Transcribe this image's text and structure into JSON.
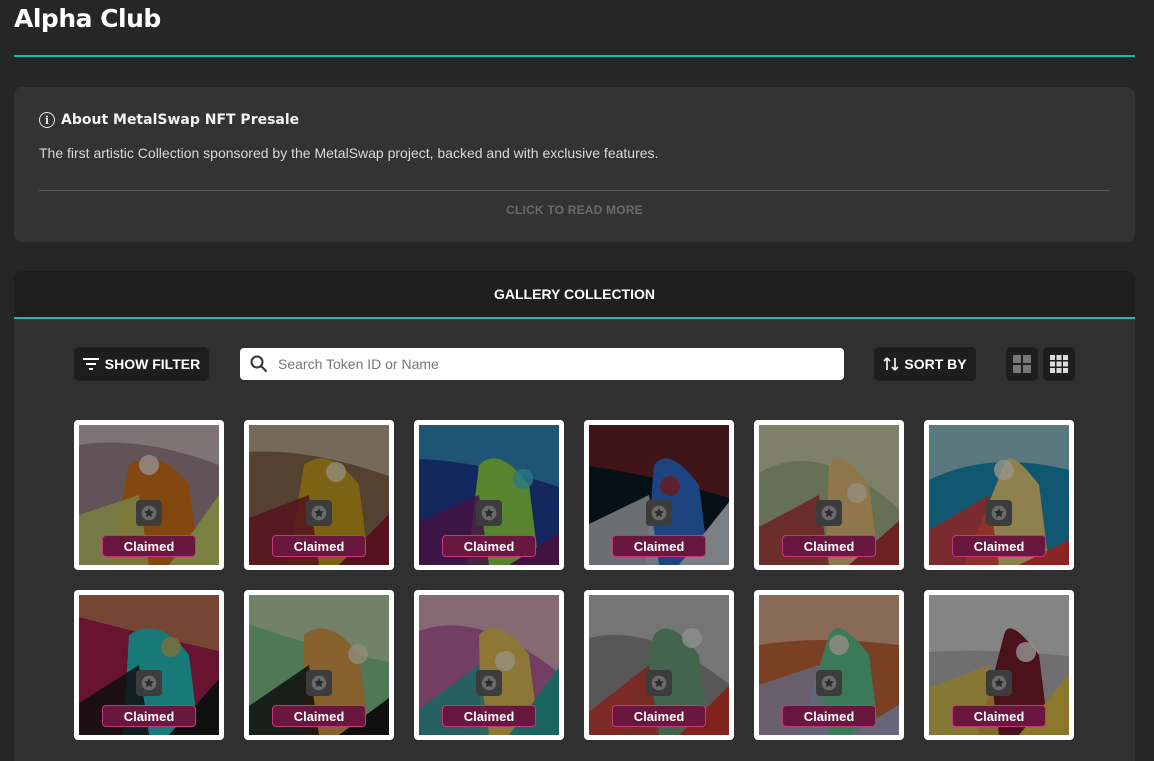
{
  "app": {
    "title": "Alpha Club"
  },
  "about": {
    "title": "About MetalSwap NFT Presale",
    "text": "The first artistic Collection sponsored by the MetalSwap project, backed and with exclusive features.",
    "read_more": "CLICK TO READ MORE"
  },
  "gallery": {
    "title": "GALLERY COLLECTION",
    "filter_label": "SHOW FILTER",
    "search_placeholder": "Search Token ID or Name",
    "sort_label": "SORT BY",
    "items": [
      {
        "status": "Claimed",
        "bg": "#9f8790",
        "c1": "#d2751a",
        "c2": "#c5d06a",
        "c3": "#f0e6e2"
      },
      {
        "status": "Claimed",
        "bg": "#8a6a4e",
        "c1": "#c9a11f",
        "c2": "#8a1d2e",
        "c3": "#e8e0c8"
      },
      {
        "status": "Claimed",
        "bg": "#1f3f9a",
        "c1": "#8fd44c",
        "c2": "#6a1f6a",
        "c3": "#42c6d8"
      },
      {
        "status": "Claimed",
        "bg": "#0c1a24",
        "c1": "#2f6fd0",
        "c2": "#c9cfd6",
        "c3": "#b22a2a"
      },
      {
        "status": "Claimed",
        "bg": "#a3b58a",
        "c1": "#e8c07a",
        "c2": "#b03838",
        "c3": "#eee3c9"
      },
      {
        "status": "Claimed",
        "bg": "#1a8fb8",
        "c1": "#e7d07c",
        "c2": "#e33a3a",
        "c3": "#f5f0e0"
      },
      {
        "status": "Claimed",
        "bg": "#a91f4e",
        "c1": "#27c3c4",
        "c2": "#1a1a1a",
        "c3": "#d0b35a"
      },
      {
        "status": "Claimed",
        "bg": "#7fc28c",
        "c1": "#d89b4a",
        "c2": "#1a1a1a",
        "c3": "#e9e0c0"
      },
      {
        "status": "Claimed",
        "bg": "#b8649e",
        "c1": "#e4c05a",
        "c2": "#2aa49a",
        "c3": "#f2e8d2"
      },
      {
        "status": "Claimed",
        "bg": "#8d8d8d",
        "c1": "#6fa47c",
        "c2": "#d2382f",
        "c3": "#e6e6e6"
      },
      {
        "status": "Claimed",
        "bg": "#c4683a",
        "c1": "#5ec58e",
        "c2": "#a6a3c6",
        "c3": "#f0e2d0"
      },
      {
        "status": "Claimed",
        "bg": "#b3b3b3",
        "c1": "#7a1e2e",
        "c2": "#e1c24a",
        "c3": "#f0f0f0"
      }
    ]
  },
  "colors": {
    "accent": "#19b8bf",
    "claimed_bg": "#6a1740",
    "claimed_border": "#c7357a"
  },
  "icons": [
    "info-icon",
    "filter-icon",
    "search-icon",
    "sort-icon",
    "grid-large-icon",
    "grid-small-icon",
    "star-icon"
  ]
}
